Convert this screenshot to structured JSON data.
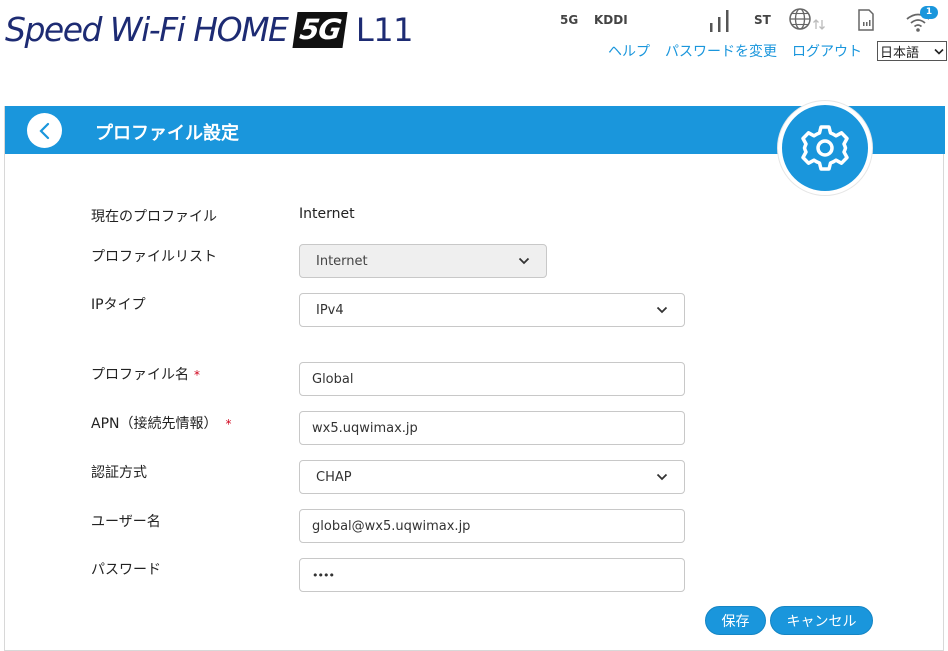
{
  "header": {
    "logo_text": "Speed Wi-Fi HOME",
    "logo_badge": "5G",
    "logo_model": "L11"
  },
  "status": {
    "network_type": "5G",
    "carrier": "KDDI",
    "st_label": "ST",
    "wifi_clients": "1"
  },
  "top_links": {
    "help": "ヘルプ",
    "change_password": "パスワードを変更",
    "logout": "ログアウト",
    "language": "日本語"
  },
  "panel": {
    "title": "プロファイル設定"
  },
  "form": {
    "current_profile": {
      "label": "現在のプロファイル",
      "value": "Internet"
    },
    "profile_list": {
      "label": "プロファイルリスト",
      "value": "Internet"
    },
    "ip_type": {
      "label": "IPタイプ",
      "value": "IPv4"
    },
    "profile_name": {
      "label": "プロファイル名",
      "required": "*",
      "value": "Global"
    },
    "apn": {
      "label": "APN（接続先情報）",
      "required": "*",
      "value": "wx5.uqwimax.jp"
    },
    "auth_method": {
      "label": "認証方式",
      "value": "CHAP"
    },
    "username": {
      "label": "ユーザー名",
      "value": "global@wx5.uqwimax.jp"
    },
    "password": {
      "label": "パスワード",
      "value": "••••"
    }
  },
  "buttons": {
    "save": "保存",
    "cancel": "キャンセル"
  },
  "colors": {
    "accent": "#1a96dc",
    "logo": "#1d2b73",
    "required": "#d0021b"
  }
}
